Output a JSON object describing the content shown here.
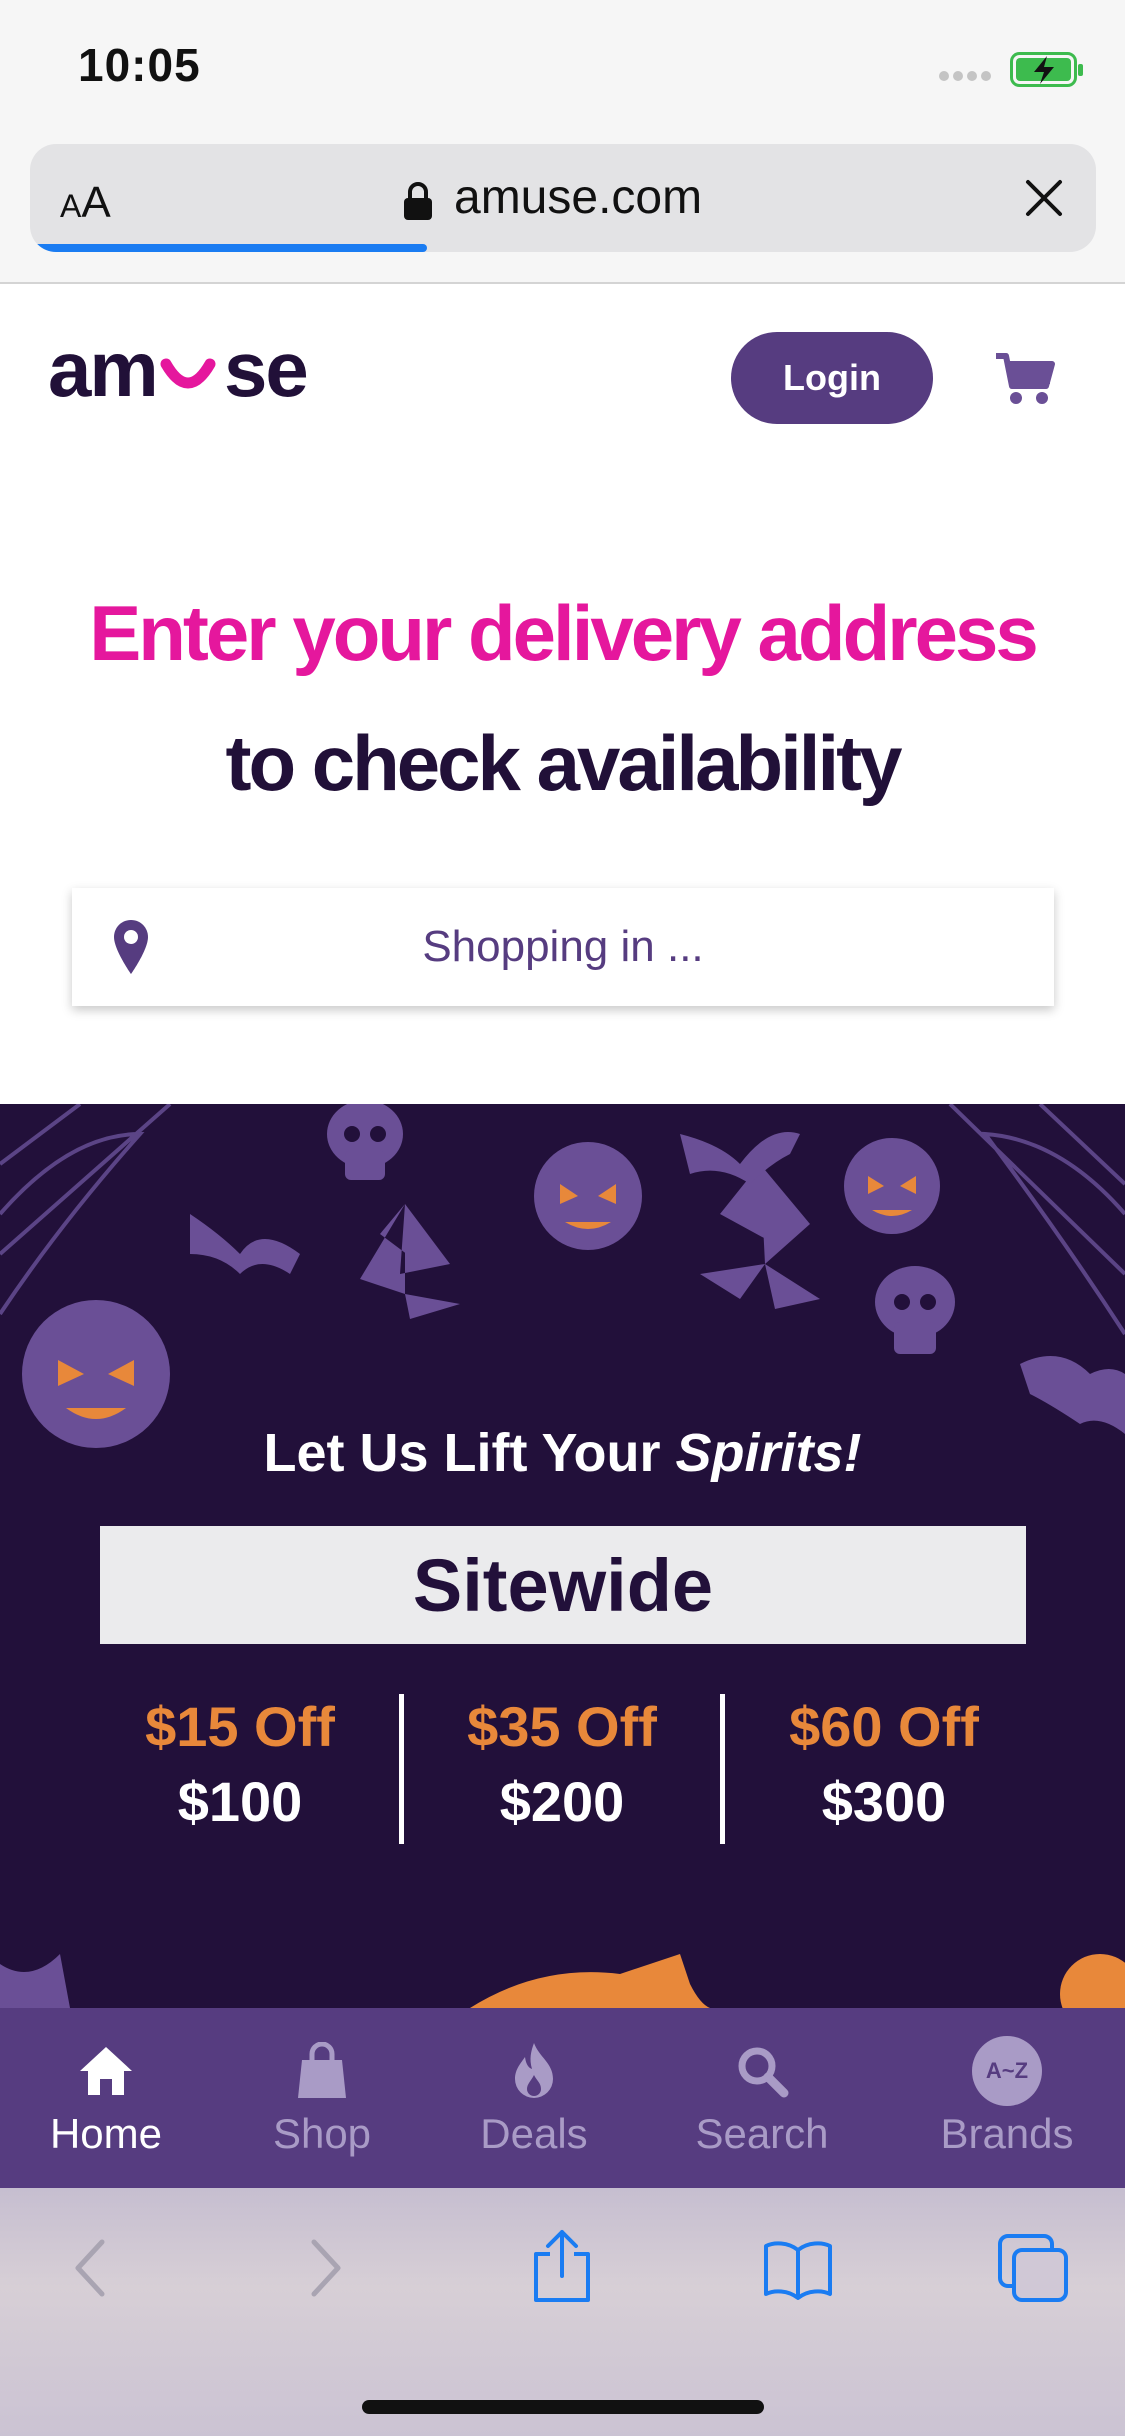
{
  "status": {
    "time": "10:05"
  },
  "browser": {
    "text_size_label_small": "A",
    "text_size_label_big": "A",
    "url": "amuse.com",
    "load_progress": 0.37
  },
  "site": {
    "logo_text": "amuse",
    "login_label": "Login",
    "headline_line1": "Enter your delivery address",
    "headline_line2": "to check availability",
    "address_placeholder": "Shopping in ..."
  },
  "banner": {
    "tagline_plain": "Let Us Lift Your ",
    "tagline_italic": "Spirits!",
    "sitewide_label": "Sitewide",
    "offers": [
      {
        "off": "$15 Off",
        "min": "$100"
      },
      {
        "off": "$35 Off",
        "min": "$200"
      },
      {
        "off": "$60 Off",
        "min": "$300"
      }
    ]
  },
  "tabs": [
    {
      "label": "Home",
      "icon": "home-icon",
      "active": true
    },
    {
      "label": "Shop",
      "icon": "shopping-bag-icon",
      "active": false
    },
    {
      "label": "Deals",
      "icon": "flame-icon",
      "active": false
    },
    {
      "label": "Search",
      "icon": "search-icon",
      "active": false
    },
    {
      "label": "Brands",
      "icon": "a-z-icon",
      "badge": "A~Z",
      "active": false
    }
  ],
  "colors": {
    "brand_purple": "#563c80",
    "brand_pink": "#e5179d",
    "dark_purple": "#22103a",
    "offer_orange": "#e8883a",
    "safari_blue": "#1a7cf2"
  }
}
